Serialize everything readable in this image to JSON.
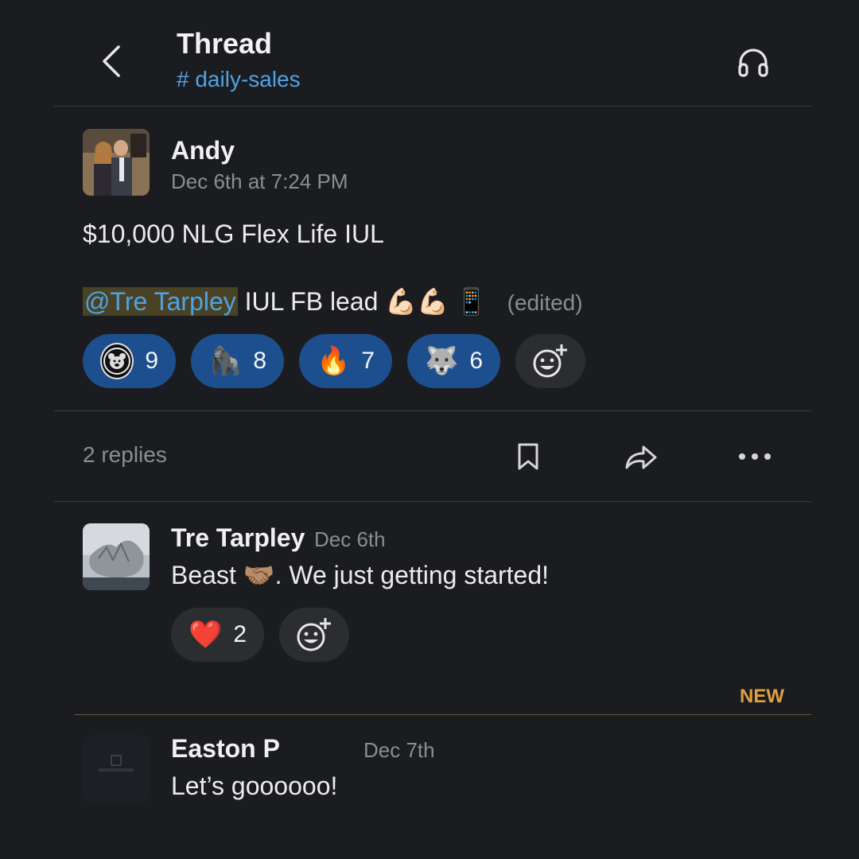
{
  "header": {
    "title": "Thread",
    "channel": "# daily-sales",
    "back_icon": "chevron-left-icon",
    "headphones_icon": "headphones-icon"
  },
  "parent_message": {
    "author": "Andy",
    "timestamp": "Dec 6th at 7:24 PM",
    "line1": "$10,000 NLG Flex Life IUL",
    "mention": "@Tre Tarpley",
    "line2_text": "IUL FB lead",
    "line2_emojis": "💪🏻💪🏻 📱",
    "edited": "(edited)",
    "reactions": [
      {
        "emoji": "bear-badge",
        "count": "9"
      },
      {
        "emoji": "🦍",
        "count": "8"
      },
      {
        "emoji": "🔥",
        "count": "7"
      },
      {
        "emoji": "🐺",
        "count": "6"
      }
    ]
  },
  "thread_bar": {
    "replies": "2 replies",
    "bookmark_icon": "bookmark-icon",
    "share_icon": "share-icon",
    "more_icon": "more-icon"
  },
  "replies": [
    {
      "author": "Tre Tarpley",
      "timestamp": "Dec 6th",
      "text": "Beast 🤝🏽. We just getting started!",
      "reactions": [
        {
          "emoji": "❤️",
          "count": "2"
        }
      ]
    },
    {
      "author": "Easton P",
      "timestamp": "Dec 7th",
      "text": "Let’s goooooo!"
    }
  ],
  "new_label": "NEW",
  "colors": {
    "background": "#1b1c1f",
    "link": "#4ea3e6",
    "reaction_active": "#1d4f8f",
    "new_accent": "#e0a040"
  }
}
